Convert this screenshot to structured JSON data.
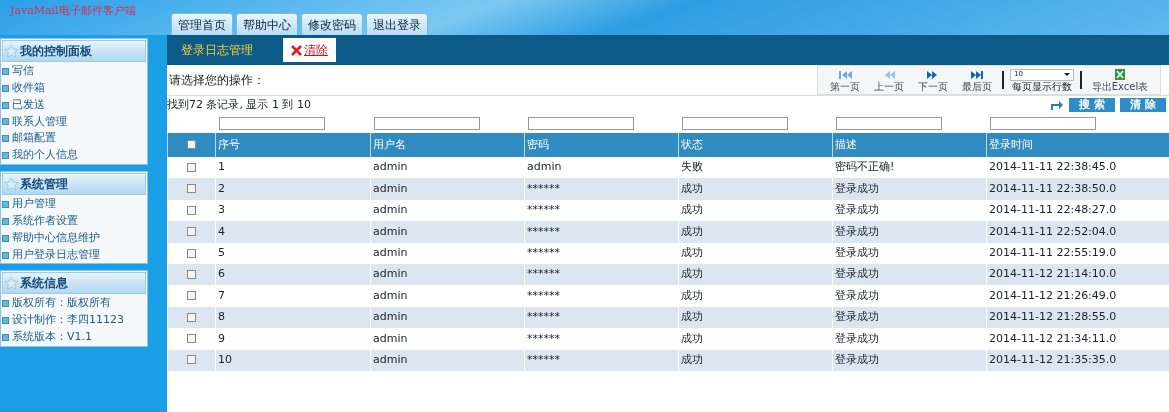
{
  "header": {
    "logo": "JavaMail电子邮件客户端",
    "nav_tabs": [
      {
        "label": "管理首页",
        "selected": false
      },
      {
        "label": "帮助中心",
        "selected": false
      },
      {
        "label": "修改密码",
        "selected": false
      },
      {
        "label": "退出登录",
        "selected": false
      }
    ]
  },
  "sidebar": [
    {
      "title": "我的控制面板",
      "items": [
        "写信",
        "收件箱",
        "已发送",
        "联系人管理",
        "邮箱配置",
        "我的个人信息"
      ]
    },
    {
      "title": "系统管理",
      "items": [
        "用户管理",
        "系统作者设置",
        "帮助中心信息维护",
        "用户登录日志管理"
      ]
    },
    {
      "title": "系统信息",
      "items": [
        "版权所有：版权所有",
        "设计制作：李四11123",
        "系统版本：V1.1"
      ]
    }
  ],
  "page_title": "登录日志管理",
  "clear_link": "清除",
  "prompt": "请选择您的操作：",
  "pager": {
    "buttons": [
      "第一页",
      "上一页",
      "下一页",
      "最后页"
    ],
    "rows_per_page": "10",
    "rows_label": "每页显示行数",
    "export": "导出Excel表"
  },
  "summary": "找到72 条记录, 显示 1 到 10",
  "search_button": "搜 索",
  "reset_button": "清 除",
  "table": {
    "select_all": false,
    "columns": [
      "序号",
      "用户名",
      "密码",
      "状态",
      "描述",
      "登录时间"
    ],
    "rows": [
      {
        "checked": false,
        "cells": [
          "1",
          "admin",
          "admin",
          "失败",
          "密码不正确!",
          "2014-11-11 22:38:45.0"
        ]
      },
      {
        "checked": false,
        "cells": [
          "2",
          "admin",
          "******",
          "成功",
          "登录成功",
          "2014-11-11 22:38:50.0"
        ]
      },
      {
        "checked": false,
        "cells": [
          "3",
          "admin",
          "******",
          "成功",
          "登录成功",
          "2014-11-11 22:48:27.0"
        ]
      },
      {
        "checked": false,
        "cells": [
          "4",
          "admin",
          "******",
          "成功",
          "登录成功",
          "2014-11-11 22:52:04.0"
        ]
      },
      {
        "checked": false,
        "cells": [
          "5",
          "admin",
          "******",
          "成功",
          "登录成功",
          "2014-11-11 22:55:19.0"
        ]
      },
      {
        "checked": false,
        "cells": [
          "6",
          "admin",
          "******",
          "成功",
          "登录成功",
          "2014-11-12 21:14:10.0"
        ]
      },
      {
        "checked": false,
        "cells": [
          "7",
          "admin",
          "******",
          "成功",
          "登录成功",
          "2014-11-12 21:26:49.0"
        ]
      },
      {
        "checked": false,
        "cells": [
          "8",
          "admin",
          "******",
          "成功",
          "登录成功",
          "2014-11-12 21:28:55.0"
        ]
      },
      {
        "checked": false,
        "cells": [
          "9",
          "admin",
          "******",
          "成功",
          "登录成功",
          "2014-11-12 21:34:11.0"
        ]
      },
      {
        "checked": false,
        "cells": [
          "10",
          "admin",
          "******",
          "成功",
          "登录成功",
          "2014-11-12 21:35:35.0"
        ]
      }
    ]
  }
}
